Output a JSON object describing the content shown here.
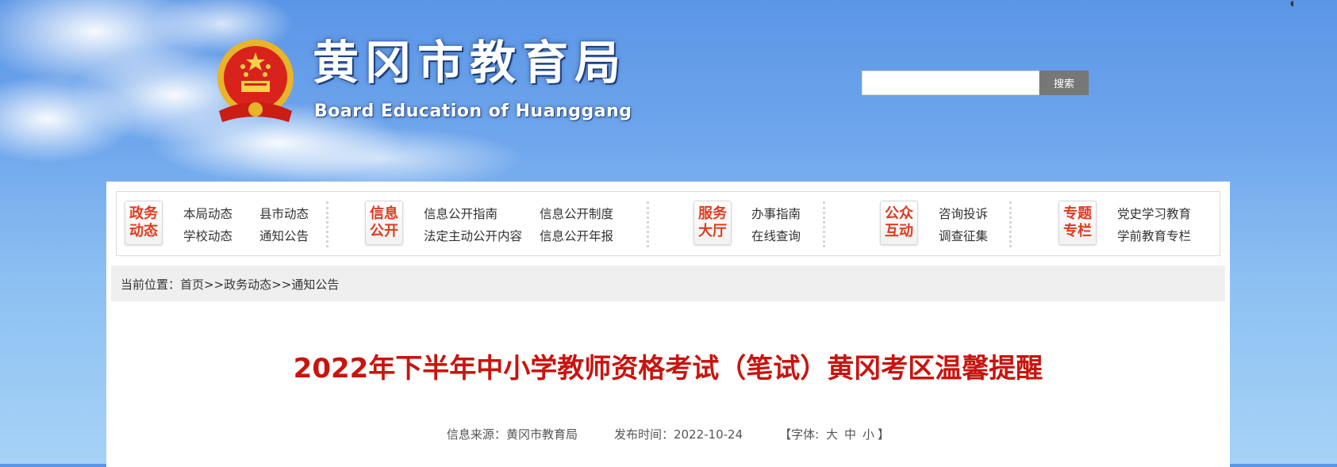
{
  "header": {
    "title": "黄冈市教育局",
    "subtitle": "Board Education of Huanggang",
    "search_placeholder": "",
    "search_button": "搜索"
  },
  "nav": {
    "groups": [
      {
        "badge": [
          "政务",
          "动态"
        ],
        "links": [
          "本局动态",
          "县市动态",
          "学校动态",
          "通知公告"
        ]
      },
      {
        "badge": [
          "信息",
          "公开"
        ],
        "links": [
          "信息公开指南",
          "信息公开制度",
          "法定主动公开内容",
          "信息公开年报"
        ]
      },
      {
        "badge": [
          "服务",
          "大厅"
        ],
        "links": [
          "办事指南",
          "在线查询"
        ]
      },
      {
        "badge": [
          "公众",
          "互动"
        ],
        "links": [
          "咨询投诉",
          "调查征集"
        ]
      },
      {
        "badge": [
          "专题",
          "专栏"
        ],
        "links": [
          "党史学习教育",
          "学前教育专栏"
        ]
      }
    ]
  },
  "breadcrumb": {
    "label": "当前位置：",
    "items": [
      "首页",
      "政务动态",
      "通知公告"
    ],
    "separator": ">>"
  },
  "article": {
    "title": "2022年下半年中小学教师资格考试（笔试）黄冈考区温馨提醒",
    "source_label": "信息来源：",
    "source": "黄冈市教育局",
    "date_label": "发布时间：",
    "date": "2022-10-24",
    "font_label": "【字体:",
    "font_sizes": [
      "大",
      "中",
      "小"
    ],
    "font_close": "】"
  },
  "colors": {
    "title_red": "#c9140f",
    "badge_red": "#e03a1f",
    "sky_blue": "#6fa6ec"
  }
}
